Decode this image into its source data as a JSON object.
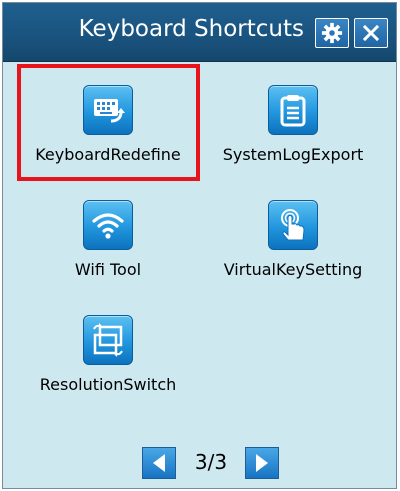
{
  "window": {
    "title": "Keyboard Shortcuts",
    "settings_icon": "gear-icon",
    "close_icon": "close-icon"
  },
  "apps": [
    {
      "label": "KeyboardRedefine",
      "icon": "keyboard-redefine-icon",
      "selected": true
    },
    {
      "label": "SystemLogExport",
      "icon": "clipboard-icon",
      "selected": false
    },
    {
      "label": "Wifi Tool",
      "icon": "wifi-icon",
      "selected": false
    },
    {
      "label": "VirtualKeySetting",
      "icon": "touch-hand-icon",
      "selected": false
    },
    {
      "label": "ResolutionSwitch",
      "icon": "resolution-switch-icon",
      "selected": false
    }
  ],
  "pager": {
    "page_text": "3/3",
    "prev_icon": "arrow-left-icon",
    "next_icon": "arrow-right-icon"
  },
  "colors": {
    "titlebar": "#1a5480",
    "background": "#cde8ee",
    "icon_blue": "#2196de",
    "highlight": "#e8141b"
  }
}
